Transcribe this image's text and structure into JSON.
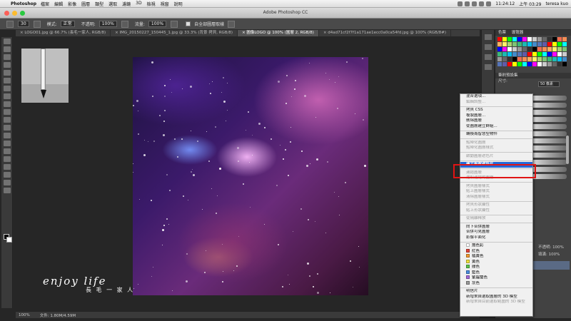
{
  "menubar": {
    "apple_icon": "apple-icon",
    "app_name": "Photoshop",
    "items": [
      "檔案",
      "編輯",
      "影像",
      "圖層",
      "類型",
      "選取",
      "濾鏡",
      "3D",
      "檢視",
      "視窗",
      "說明"
    ],
    "time": "11:24:12",
    "alt_time": "上午 03:29",
    "user": "teresa kuo"
  },
  "window": {
    "title": "Adobe Photoshop CC"
  },
  "options_bar": {
    "size": "30",
    "mode_label": "模式:",
    "mode_value": "正常",
    "opacity_label": "不透明:",
    "opacity_value": "100%",
    "flow_label": "流量:",
    "flow_value": "100%",
    "sample_label": "自全部圖層取樣"
  },
  "tabs": [
    {
      "label": "LOGO01.jpg @ 66.7% (長毛一家人, RGB/8)",
      "active": false
    },
    {
      "label": "IMG_20150227_150445_1.jpg @ 33.3% (背景 拷貝, RGB/8)",
      "active": false
    },
    {
      "label": "圖像LOGO @ 100% (圖層 2, RGB/8)",
      "active": true
    },
    {
      "label": "d4ad71cf2f7f1a171ae1ecc0a0ca54fd.jpg @ 100% (RGB/8#)",
      "active": false
    }
  ],
  "status": {
    "zoom": "100%",
    "doc_size": "文件: 1.80M/4.59M"
  },
  "watermark": {
    "main": "enjoy life",
    "sub": "長 毛 一 家 人"
  },
  "right_panel": {
    "swatch_title": "色票",
    "swatch_tab2": "導覽器",
    "brush_title": "筆刷預設集",
    "size_label": "尺寸:",
    "size_value": "50 像素",
    "layers_title": "圖層",
    "opacity_label": "不透明:",
    "opacity_value": "100%",
    "fill_label": "填滿:",
    "fill_value": "100%"
  },
  "context_menu": {
    "items": [
      {
        "label": "混合選項...",
        "disabled": false
      },
      {
        "label": "編輯調整...",
        "disabled": true
      },
      {
        "sep": true
      },
      {
        "label": "拷貝 CSS",
        "disabled": false
      },
      {
        "label": "複製圖層...",
        "disabled": false
      },
      {
        "label": "刪除圖層",
        "disabled": false
      },
      {
        "label": "從圖層建立群組...",
        "disabled": false
      },
      {
        "sep": true
      },
      {
        "label": "轉換為智慧型物件",
        "disabled": false
      },
      {
        "sep": true
      },
      {
        "label": "點陣化圖層",
        "disabled": true
      },
      {
        "label": "點陣化圖層樣式",
        "disabled": true
      },
      {
        "sep": true
      },
      {
        "label": "啟動圖層遮色片",
        "disabled": true
      },
      {
        "sep": true
      },
      {
        "label": "建立剪裁遮色片",
        "disabled": false,
        "selected": true
      },
      {
        "sep": true
      },
      {
        "label": "連結圖層",
        "disabled": true
      },
      {
        "label": "選取連結的圖層",
        "disabled": true
      },
      {
        "sep": true
      },
      {
        "label": "拷貝圖層樣式",
        "disabled": true
      },
      {
        "label": "貼上圖層樣式",
        "disabled": true
      },
      {
        "label": "清除圖層樣式",
        "disabled": true
      },
      {
        "sep": true
      },
      {
        "label": "拷貝形狀屬性",
        "disabled": true
      },
      {
        "label": "貼上形狀屬性",
        "disabled": true
      },
      {
        "sep": true
      },
      {
        "label": "從隔離釋放",
        "disabled": true
      },
      {
        "sep": true
      },
      {
        "label": "向下合併圖層",
        "disabled": false
      },
      {
        "label": "合併可見圖層",
        "disabled": false
      },
      {
        "label": "影像平面化",
        "disabled": false
      },
      {
        "sep": true
      },
      {
        "label": "無色彩",
        "disabled": false,
        "swatch": "#ffffff"
      },
      {
        "label": "紅色",
        "disabled": false,
        "swatch": "#e0443a"
      },
      {
        "label": "橘黃色",
        "disabled": false,
        "swatch": "#f29a2e"
      },
      {
        "label": "黃色",
        "disabled": false,
        "swatch": "#f1e03a"
      },
      {
        "label": "綠色",
        "disabled": false,
        "swatch": "#5cc24a"
      },
      {
        "label": "藍色",
        "disabled": false,
        "swatch": "#4a8ee0"
      },
      {
        "label": "紫羅蘭色",
        "disabled": false,
        "swatch": "#a26ad8"
      },
      {
        "label": "灰色",
        "disabled": false,
        "swatch": "#9a9a9a"
      },
      {
        "sep": true
      },
      {
        "label": "明信片",
        "disabled": false
      },
      {
        "label": "新增來自選取圖層的 3D 模型",
        "disabled": false
      },
      {
        "label": "新增來自目前選取範圍的 3D 模型",
        "disabled": true
      }
    ]
  },
  "colors": {
    "selected_bg": "#2468d8",
    "highlight_border": "#e01414",
    "app_bg": "#262626"
  }
}
